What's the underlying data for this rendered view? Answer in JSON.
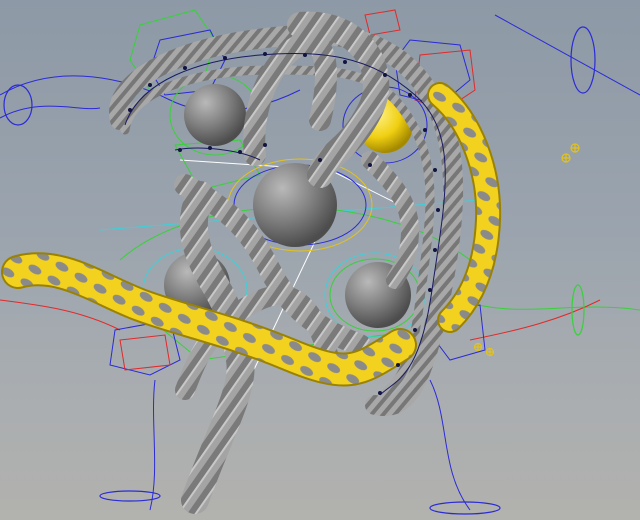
{
  "app": {
    "window": "3d-viewport",
    "background_gradient": [
      "#8d99a6",
      "#b2b2ae"
    ]
  },
  "scene": {
    "description_tags": [
      "rope-tube",
      "spheres",
      "rig-controls",
      "locators"
    ],
    "colors": {
      "rope": "#9c9c9c",
      "rope_shade": "#6e6e6e",
      "rope_highlight": "#c9c9c9",
      "tube_yellow": "#f2d21f",
      "tube_spots": "#8a8a8a",
      "sphere": "#7d7d7d",
      "control_blue": "#2b2bd6",
      "control_green": "#37d13a",
      "control_red": "#e02a2a",
      "control_cyan": "#3fd0d8",
      "locator_yellow": "#e3c21b"
    },
    "spheres": [
      {
        "id": "sphere-top-left"
      },
      {
        "id": "sphere-top-right-yellow"
      },
      {
        "id": "sphere-center"
      },
      {
        "id": "sphere-bottom-left"
      },
      {
        "id": "sphere-bottom-right"
      }
    ]
  }
}
